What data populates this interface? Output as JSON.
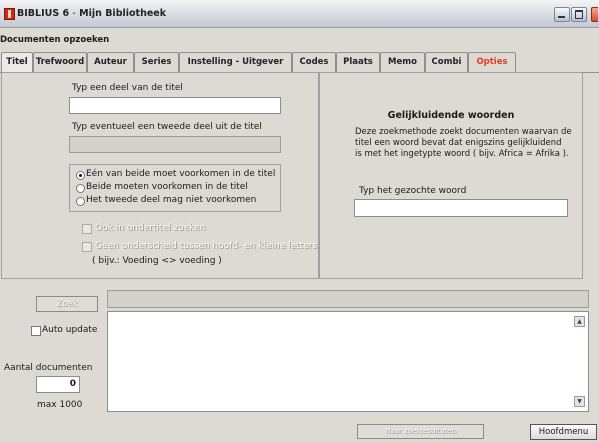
{
  "window": {
    "app_name": "BIBLIUS 6",
    "separator": "-",
    "library_name": "Mijn Bibliotheek",
    "minimize_icon": "minimize-icon",
    "maximize_icon": "maximize-icon",
    "close_icon": "close-icon"
  },
  "section_title": "Documenten opzoeken",
  "tabs": [
    {
      "label": "Titel",
      "active": true
    },
    {
      "label": "Trefwoord"
    },
    {
      "label": "Auteur"
    },
    {
      "label": "Series"
    },
    {
      "label": "Instelling - Uitgever"
    },
    {
      "label": "Codes"
    },
    {
      "label": "Plaats"
    },
    {
      "label": "Memo"
    },
    {
      "label": "Combi"
    },
    {
      "label": "Opties",
      "color": "#e23a2a"
    }
  ],
  "title_search": {
    "label1": "Typ een deel van de titel",
    "value1": "",
    "label2": "Typ eventueel een tweede deel uit de titel",
    "value2": "",
    "radios": [
      {
        "label": "Eén van beide moet voorkomen in de titel",
        "selected": true
      },
      {
        "label": "Beide moeten voorkomen in de titel",
        "selected": false
      },
      {
        "label": "Het tweede deel mag niet voorkomen",
        "selected": false
      }
    ],
    "check1_label": "Ook in ondertitel zoeken",
    "check2_label": "Geen onderscheid tussen hoofd- en kleine letters",
    "example": "( bijv.: Voeding <> voeding )"
  },
  "fuzzy": {
    "heading": "Gelijkluidende woorden",
    "description": [
      "Deze zoekmethode zoekt documenten waarvan de",
      "titel een woord bevat dat enigszins gelijkluidend",
      "is met het ingetypte woord ( bijv.  Africa = Afrika )."
    ],
    "input_label": "Typ het gezochte woord",
    "input_value": ""
  },
  "bottom": {
    "search_button": "Zoek",
    "query_value": "",
    "auto_update_label": "Auto update",
    "auto_update_checked": false,
    "count_label": "Aantal documenten",
    "count_value": "0",
    "max_label": "max 1000",
    "results_value": "",
    "lower_button": "Naar zoekresultaten",
    "main_menu_button": "Hoofdmenu"
  }
}
